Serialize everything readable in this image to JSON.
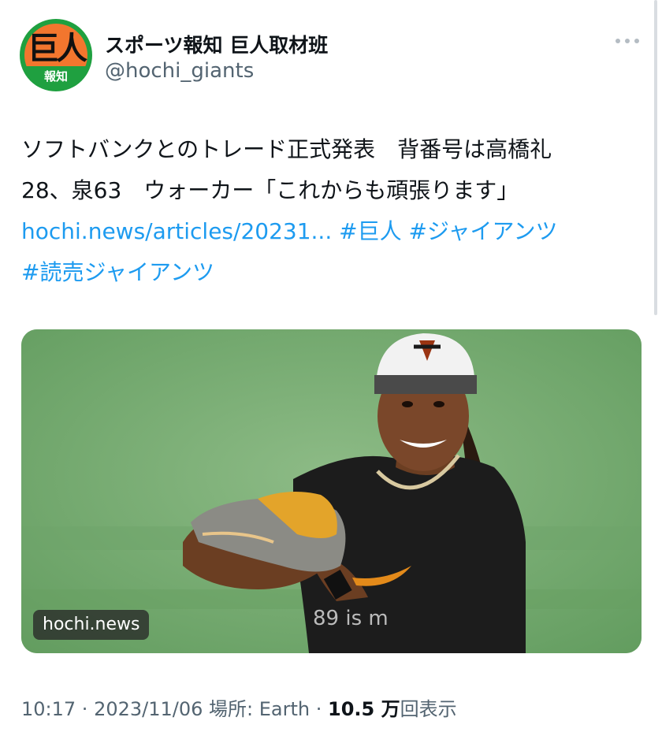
{
  "account": {
    "avatar_main": "巨人",
    "avatar_sub": "報知",
    "display_name": "スポーツ報知 巨人取材班",
    "handle": "@hochi_giants"
  },
  "tweet": {
    "line1": "ソフトバンクとのトレード正式発表　背番号は高橋礼",
    "line2": "28、泉63　ウォーカー「これからも頑張ります」",
    "link": "hochi.news/articles/20231...",
    "tag1": "#巨人",
    "tag2": "#ジャイアンツ",
    "tag3": "#読売ジャイアンツ"
  },
  "media": {
    "source_badge": "hochi.news",
    "shirt_text": "89 is m"
  },
  "meta": {
    "time": "10:17",
    "separator": " · ",
    "date": "2023/11/06",
    "location": "場所: Earth",
    "views_count": "10.5 万",
    "views_label": "回表示"
  },
  "colors": {
    "link": "#1d9bf0",
    "text": "#0f1419",
    "secondary": "#536471",
    "avatar_orange": "#f2762e",
    "avatar_green": "#1fa040"
  },
  "icons": {
    "more": "more-horizontal-icon"
  }
}
